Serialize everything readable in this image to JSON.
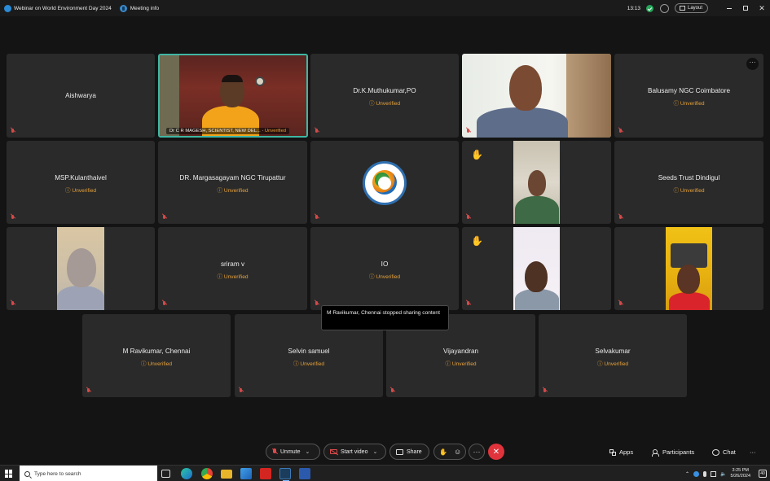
{
  "titlebar": {
    "title": "Webinar on World Environment Day 2024",
    "meeting_info": "Meeting info",
    "time": "13:13",
    "layout_label": "Layout",
    "minimize": "—",
    "restore": "❐",
    "close": "✕"
  },
  "tiles": [
    {
      "name": "Aishwarya",
      "unverified": ""
    },
    {
      "name": "Dr C R MAGESH, SCIENTIST, NEW DEL...",
      "unverified": "Unverified"
    },
    {
      "name": "Dr.K.Muthukumar,PO",
      "unverified": "Unverified"
    },
    {
      "name": "",
      "unverified": ""
    },
    {
      "name": "Balusamy NGC Coimbatore",
      "unverified": "Unverified"
    },
    {
      "name": "MSP.Kulanthaivel",
      "unverified": "Unverified"
    },
    {
      "name": "DR. Margasagayam NGC Tirupattur",
      "unverified": "Unverified"
    },
    {
      "name": "",
      "unverified": ""
    },
    {
      "name": "",
      "unverified": ""
    },
    {
      "name": "Seeds Trust Dindigul",
      "unverified": "Unverified"
    },
    {
      "name": "",
      "unverified": ""
    },
    {
      "name": "sriram v",
      "unverified": "Unverified"
    },
    {
      "name": "IO",
      "unverified": "Unverified"
    },
    {
      "name": "",
      "unverified": ""
    },
    {
      "name": "",
      "unverified": ""
    },
    {
      "name": "M Ravikumar, Chennai",
      "unverified": "Unverified"
    },
    {
      "name": "Selvin samuel",
      "unverified": "Unverified"
    },
    {
      "name": "Vijayandran",
      "unverified": "Unverified"
    },
    {
      "name": "Selvakumar",
      "unverified": "Unverified"
    }
  ],
  "toast": "M Ravikumar, Chennai stopped sharing content",
  "controls": {
    "unmute": "Unmute",
    "start_video": "Start video",
    "share": "Share",
    "more": "···",
    "leave": "✕",
    "apps": "Apps",
    "participants": "Participants",
    "chat": "Chat",
    "overflow": "···"
  },
  "taskbar": {
    "search_placeholder": "Type here to search",
    "time": "3:25 PM",
    "date": "5/26/2024",
    "notifications": "40"
  },
  "colors": {
    "speaker_border": "#3fb6a4",
    "unverified": "#e6a23c",
    "leave": "#e0333b",
    "muted": "#d44a4a"
  }
}
